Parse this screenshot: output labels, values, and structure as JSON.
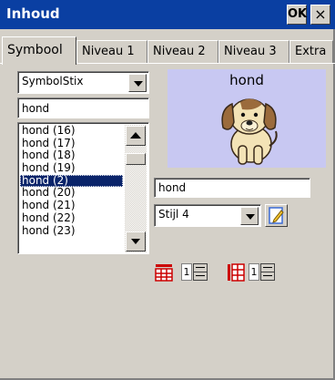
{
  "window": {
    "title": "Inhoud",
    "ok_label": "OK",
    "close_label": "×"
  },
  "tabs": [
    {
      "label": "Symbool",
      "active": true
    },
    {
      "label": "Niveau 1",
      "active": false
    },
    {
      "label": "Niveau 2",
      "active": false
    },
    {
      "label": "Niveau 3",
      "active": false
    },
    {
      "label": "Extra",
      "active": false
    }
  ],
  "symbol_set": {
    "selected": "SymbolStix"
  },
  "search": {
    "value": "hond"
  },
  "results": {
    "items": [
      "hond (16)",
      "hond (17)",
      "hond (18)",
      "hond (19)",
      "hond (2)",
      "hond (20)",
      "hond (21)",
      "hond (22)",
      "hond (23)"
    ],
    "selected_index": 4
  },
  "preview": {
    "label": "hond",
    "background": "#c8c8f2"
  },
  "caption": {
    "value": "hond"
  },
  "style": {
    "selected": "Stijl 4"
  },
  "rows": {
    "value": "1"
  },
  "columns": {
    "value": "1"
  },
  "colors": {
    "selection": "#0a246a",
    "titlebar": "#0a3fa2",
    "grid_icon": "#cc0000"
  }
}
